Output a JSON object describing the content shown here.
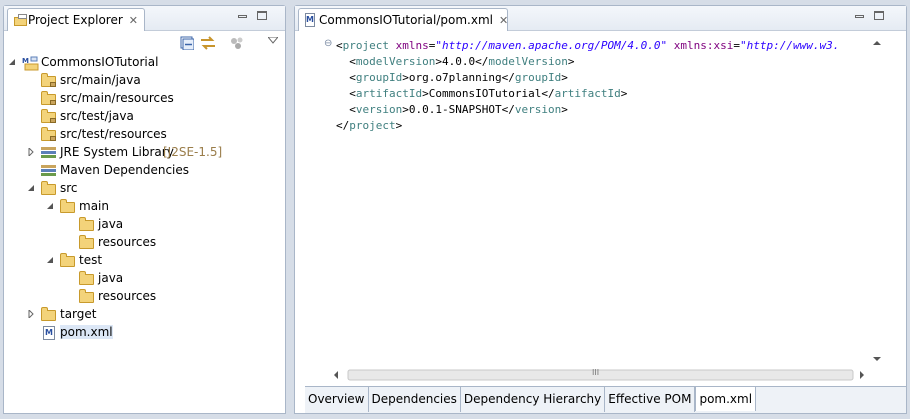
{
  "explorer": {
    "tab_label": "Project Explorer",
    "close_glyph": "✕",
    "tree": [
      {
        "name": "project-row",
        "text": "CommonsIOTutorial",
        "indent": 0,
        "twisty": "open",
        "icon": "maven-project-icon"
      },
      {
        "name": "source-folder-row",
        "text": "src/main/java",
        "indent": 1,
        "twisty": "",
        "icon": "package-folder-icon"
      },
      {
        "name": "source-folder-row",
        "text": "src/main/resources",
        "indent": 1,
        "twisty": "",
        "icon": "package-folder-icon"
      },
      {
        "name": "source-folder-row",
        "text": "src/test/java",
        "indent": 1,
        "twisty": "",
        "icon": "package-folder-icon"
      },
      {
        "name": "source-folder-row",
        "text": "src/test/resources",
        "indent": 1,
        "twisty": "",
        "icon": "package-folder-icon"
      },
      {
        "name": "library-row",
        "text": "JRE System Library",
        "decoration": "[J2SE-1.5]",
        "indent": 1,
        "twisty": "closed",
        "icon": "library-icon"
      },
      {
        "name": "library-row",
        "text": "Maven Dependencies",
        "indent": 1,
        "twisty": "",
        "icon": "library-icon"
      },
      {
        "name": "folder-row",
        "text": "src",
        "indent": 1,
        "twisty": "open",
        "icon": "folder-icon"
      },
      {
        "name": "folder-row",
        "text": "main",
        "indent": 2,
        "twisty": "open",
        "icon": "folder-icon"
      },
      {
        "name": "folder-row",
        "text": "java",
        "indent": 3,
        "twisty": "",
        "icon": "folder-icon"
      },
      {
        "name": "folder-row",
        "text": "resources",
        "indent": 3,
        "twisty": "",
        "icon": "folder-icon"
      },
      {
        "name": "folder-row",
        "text": "test",
        "indent": 2,
        "twisty": "open",
        "icon": "folder-icon"
      },
      {
        "name": "folder-row",
        "text": "java",
        "indent": 3,
        "twisty": "",
        "icon": "folder-icon"
      },
      {
        "name": "folder-row",
        "text": "resources",
        "indent": 3,
        "twisty": "",
        "icon": "folder-icon"
      },
      {
        "name": "folder-row",
        "text": "target",
        "indent": 1,
        "twisty": "closed",
        "icon": "folder-icon"
      },
      {
        "name": "file-row",
        "text": "pom.xml",
        "indent": 1,
        "twisty": "",
        "icon": "maven-file-icon",
        "selected": true
      }
    ]
  },
  "editor": {
    "tab_label": "CommonsIOTutorial/pom.xml",
    "close_glyph": "✕",
    "hscroll_thumb": "III",
    "code": [
      [
        [
          "x",
          "<"
        ],
        [
          "t",
          "project"
        ],
        [
          "x",
          " "
        ],
        [
          "a",
          "xmlns"
        ],
        [
          "x",
          "="
        ],
        [
          "v",
          "\"http://maven.apache.org/POM/4.0.0\""
        ],
        [
          "x",
          " "
        ],
        [
          "a",
          "xmlns:xsi"
        ],
        [
          "x",
          "="
        ],
        [
          "v",
          "\"http://www.w3."
        ]
      ],
      [
        [
          "x",
          "  <"
        ],
        [
          "t",
          "modelVersion"
        ],
        [
          "x",
          ">4.0.0</"
        ],
        [
          "t",
          "modelVersion"
        ],
        [
          "x",
          ">"
        ]
      ],
      [
        [
          "x",
          "  <"
        ],
        [
          "t",
          "groupId"
        ],
        [
          "x",
          ">org.o7planning</"
        ],
        [
          "t",
          "groupId"
        ],
        [
          "x",
          ">"
        ]
      ],
      [
        [
          "x",
          "  <"
        ],
        [
          "t",
          "artifactId"
        ],
        [
          "x",
          ">CommonsIOTutorial</"
        ],
        [
          "t",
          "artifactId"
        ],
        [
          "x",
          ">"
        ]
      ],
      [
        [
          "x",
          "  <"
        ],
        [
          "t",
          "version"
        ],
        [
          "x",
          ">0.0.1-SNAPSHOT</"
        ],
        [
          "t",
          "version"
        ],
        [
          "x",
          ">"
        ]
      ],
      [
        [
          "x",
          "</"
        ],
        [
          "t",
          "project"
        ],
        [
          "x",
          ">"
        ]
      ]
    ],
    "bottom_tabs": [
      "Overview",
      "Dependencies",
      "Dependency Hierarchy",
      "Effective POM",
      "pom.xml"
    ],
    "active_bottom_tab": "pom.xml"
  },
  "colors": {
    "tag": "#3f7f7f",
    "attribute": "#7f007f",
    "value": "#2a00ff"
  }
}
